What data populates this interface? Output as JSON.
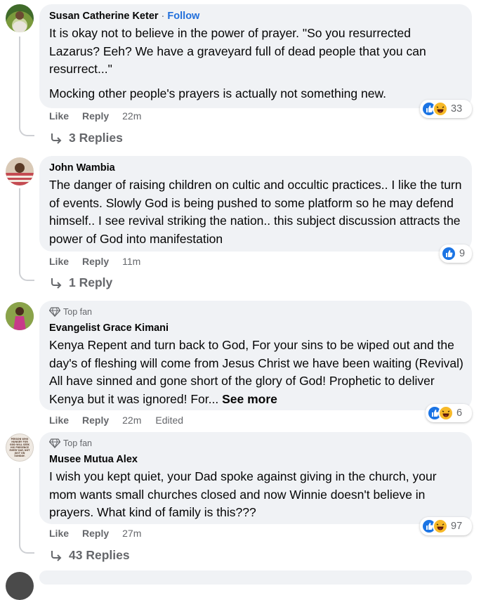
{
  "comments": [
    {
      "author": "Susan Catherine Keter",
      "separator": " · ",
      "follow": "Follow",
      "top_fan": "",
      "paragraphs": [
        "It is okay not to believe in the power of prayer. \"So you resurrected Lazarus? Eeh? We have a graveyard full of dead people that you can resurrect...\"",
        "Mocking other people's prayers is actually not something new."
      ],
      "actions": {
        "like": "Like",
        "reply": "Reply",
        "time": "22m",
        "edited": ""
      },
      "reactions": {
        "types": [
          "like",
          "haha"
        ],
        "count": "33"
      },
      "replies": "3 Replies"
    },
    {
      "author": "John Wambia",
      "top_fan": "",
      "paragraphs": [
        "The danger of raising children on cultic and occultic practices.. I like the turn of events. Slowly God is being pushed to some platform so he may defend himself.. I see revival striking the nation.. this subject discussion attracts the power of God into manifestation"
      ],
      "actions": {
        "like": "Like",
        "reply": "Reply",
        "time": "11m",
        "edited": ""
      },
      "reactions": {
        "types": [
          "like"
        ],
        "count": "9"
      },
      "replies": "1 Reply"
    },
    {
      "author": "Evangelist Grace Kimani",
      "top_fan": "Top fan",
      "paragraphs": [
        "Kenya Repent and turn back to God, For your sins to be wiped out and the day's of fleshing will come from Jesus Christ we have been waiting (Revival) All have sinned and gone short of the glory of God! Prophetic to deliver Kenya but it was ignored! For..."
      ],
      "see_more": "See more",
      "actions": {
        "like": "Like",
        "reply": "Reply",
        "time": "22m",
        "edited": "Edited"
      },
      "reactions": {
        "types": [
          "like",
          "haha"
        ],
        "count": "6"
      },
      "replies": ""
    },
    {
      "author": "Musee Mutua Alex",
      "top_fan": "Top fan",
      "avatar_text": "PERSON WHO HUNGRY FOR GOD WILL SEEK HIS PRESENCE EVERY DAY, NOT JUST ON SUNDAY.",
      "paragraphs": [
        "I wish you kept quiet, your Dad spoke against giving in the church, your mom wants small churches closed and now Winnie doesn't believe in prayers. What kind of family is this???"
      ],
      "actions": {
        "like": "Like",
        "reply": "Reply",
        "time": "27m",
        "edited": ""
      },
      "reactions": {
        "types": [
          "like",
          "haha"
        ],
        "count": "97"
      },
      "replies": "43 Replies"
    }
  ],
  "colors": {
    "bubble": "#f0f2f5",
    "secondary_text": "#65676b",
    "follow_link": "#216fdb",
    "like_blue": "#1b74e4",
    "haha_yellow": "#f7b928"
  },
  "icons": {
    "top_fan": "diamond-badge-icon",
    "reply_arrow": "reply-arrow-icon",
    "like": "like-reaction-icon",
    "haha": "haha-reaction-icon"
  }
}
